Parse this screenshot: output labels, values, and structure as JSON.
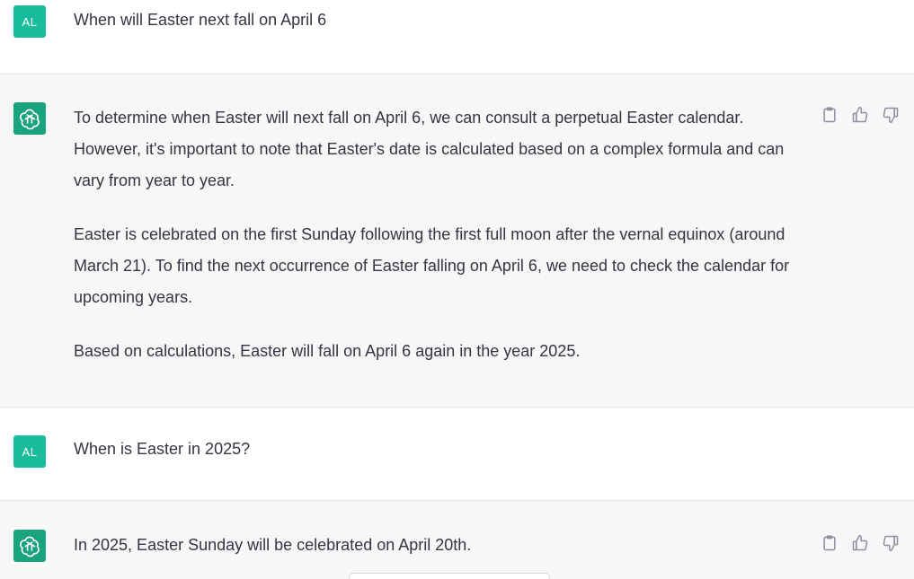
{
  "messages": [
    {
      "role": "user",
      "avatar_text": "AL",
      "paragraphs": [
        "When will Easter next fall on April 6"
      ]
    },
    {
      "role": "assistant",
      "avatar_icon": "openai-logo-icon",
      "paragraphs": [
        "To determine when Easter will next fall on April 6, we can consult a perpetual Easter calendar. However, it's important to note that Easter's date is calculated based on a complex formula and can vary from year to year.",
        "Easter is celebrated on the first Sunday following the first full moon after the vernal equinox (around March 21). To find the next occurrence of Easter falling on April 6, we need to check the calendar for upcoming years.",
        "Based on calculations, Easter will fall on April 6 again in the year 2025."
      ],
      "actions": [
        "copy-icon",
        "thumbs-up-icon",
        "thumbs-down-icon"
      ]
    },
    {
      "role": "user",
      "avatar_text": "AL",
      "paragraphs": [
        "When is Easter in 2025?"
      ]
    },
    {
      "role": "assistant",
      "avatar_icon": "openai-logo-icon",
      "paragraphs": [
        "In 2025, Easter Sunday will be celebrated on April 20th."
      ],
      "actions": [
        "copy-icon",
        "thumbs-up-icon",
        "thumbs-down-icon"
      ]
    }
  ],
  "colors": {
    "user_bg": "#ffffff",
    "assistant_bg": "#f7f7f8",
    "user_avatar": "#1abc9c",
    "assistant_avatar": "#19a37f",
    "text": "#343541",
    "icon": "#8e8ea0"
  }
}
